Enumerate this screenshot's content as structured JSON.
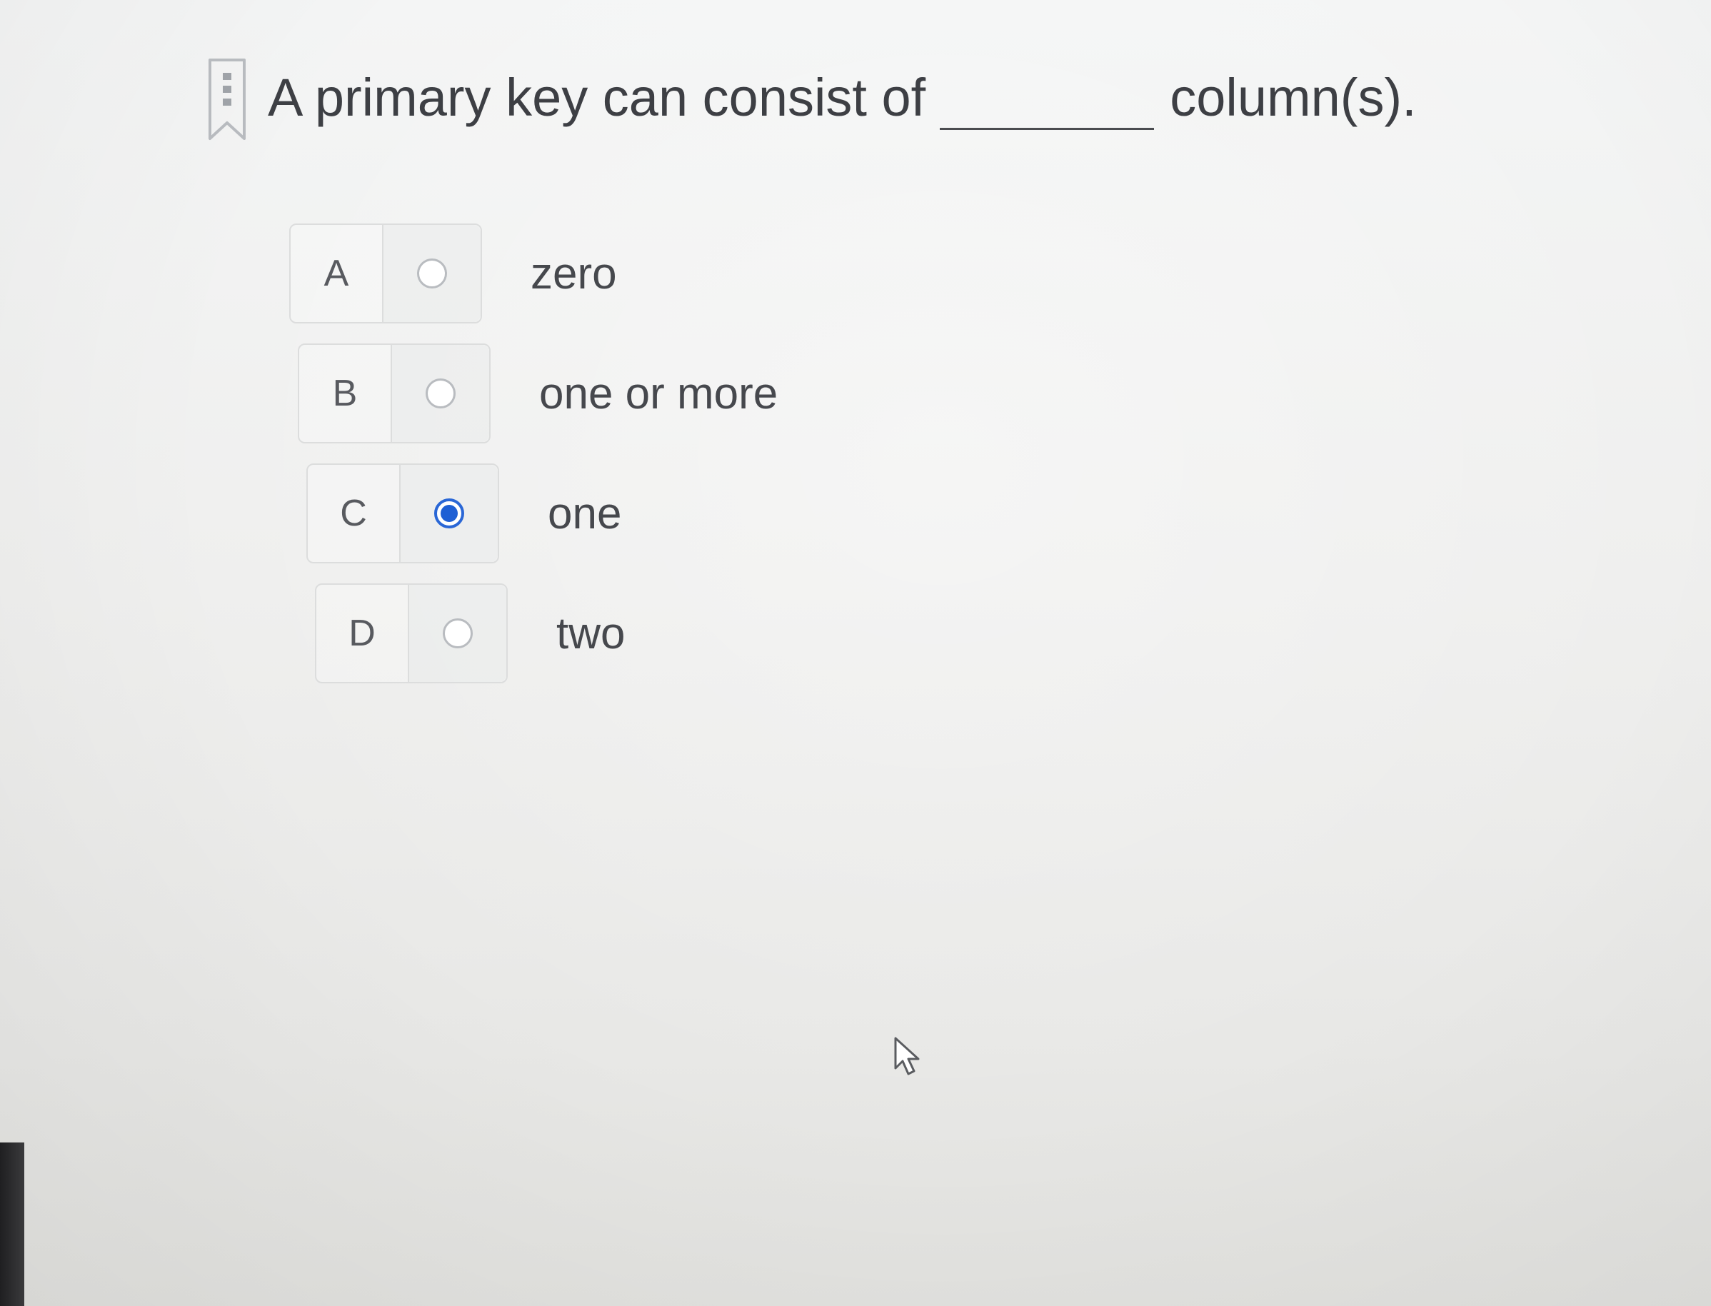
{
  "question": {
    "before_blank": "A primary key can consist of",
    "after_blank": "column(s)."
  },
  "options": [
    {
      "letter": "A",
      "text": "zero",
      "selected": false
    },
    {
      "letter": "B",
      "text": "one or more",
      "selected": false
    },
    {
      "letter": "C",
      "text": "one",
      "selected": true
    },
    {
      "letter": "D",
      "text": "two",
      "selected": false
    }
  ],
  "icons": {
    "bookmark": "bookmark-icon",
    "cursor": "mouse-pointer-icon"
  },
  "colors": {
    "selected_radio": "#1e5fd4",
    "background": "#efefee"
  }
}
